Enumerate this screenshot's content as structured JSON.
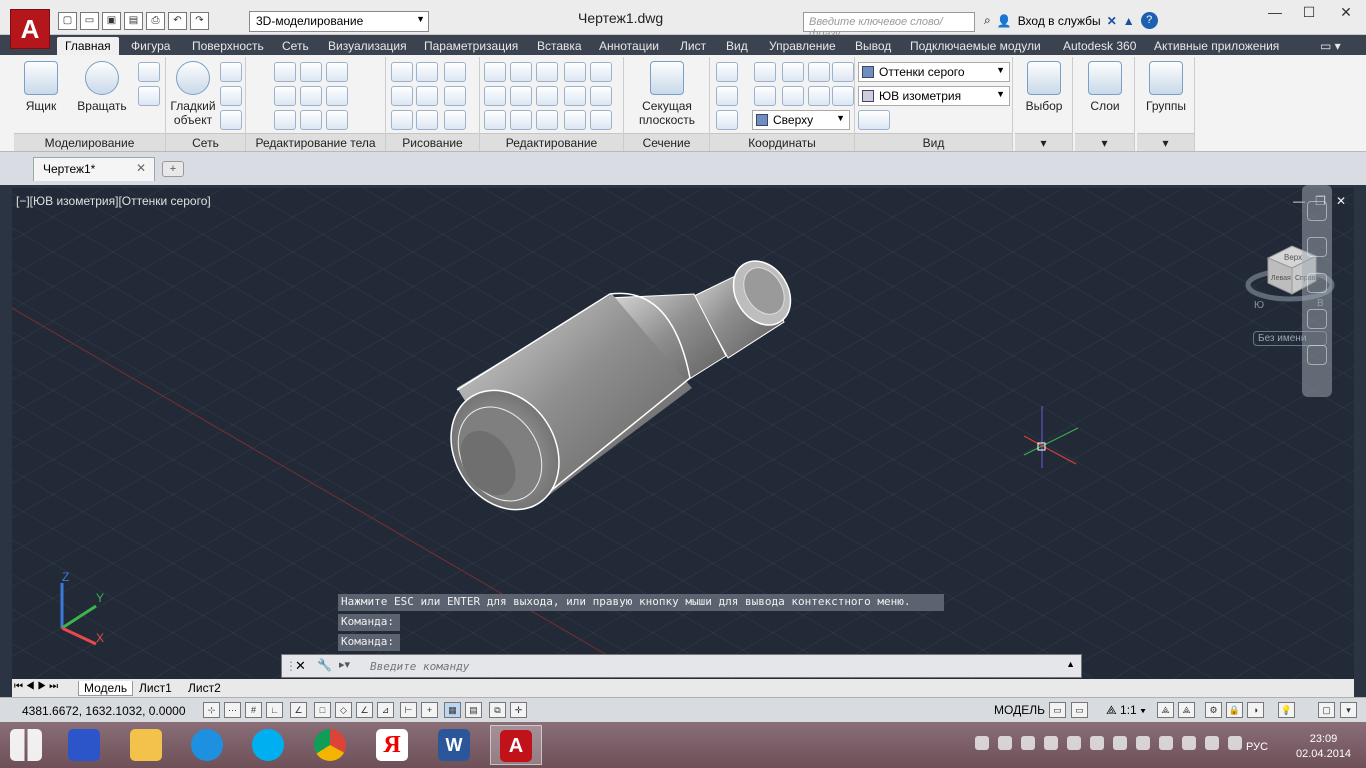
{
  "app": {
    "logo_letter": "A",
    "workspace": "3D-моделирование",
    "doc_title": "Чертеж1.dwg",
    "search_placeholder": "Введите ключевое слово/фразу",
    "signin_label": "Вход в службы"
  },
  "ribbon_tabs": [
    "Главная",
    "Фигура",
    "Поверхность",
    "Сеть",
    "Визуализация",
    "Параметризация",
    "Вставка",
    "Аннотации",
    "Лист",
    "Вид",
    "Управление",
    "Вывод",
    "Подключаемые модули",
    "Autodesk 360",
    "Активные приложения"
  ],
  "panels": {
    "modeling": {
      "label": "Моделирование",
      "box": "Ящик",
      "revolve": "Вращать"
    },
    "mesh": {
      "label": "Сеть",
      "smooth_l1": "Гладкий",
      "smooth_l2": "объект"
    },
    "solid_edit": {
      "label": "Редактирование тела"
    },
    "draw": {
      "label": "Рисование"
    },
    "modify": {
      "label": "Редактирование"
    },
    "section": {
      "label": "Сечение",
      "plane_l1": "Секущая",
      "plane_l2": "плоскость"
    },
    "coords": {
      "label": "Координаты",
      "ucs_view": "Сверху"
    },
    "view": {
      "label": "Вид",
      "visual_style": "Оттенки серого",
      "view_name": "ЮВ изометрия"
    },
    "selection": {
      "label": "Выбор"
    },
    "layers": {
      "label": "Слои"
    },
    "groups": {
      "label": "Группы"
    }
  },
  "file_tab": {
    "name": "Чертеж1*"
  },
  "viewport": {
    "label": "[−][ЮВ изометрия][Оттенки серого]",
    "viewcube_named": "Без имени",
    "viewcube_top": "Верх",
    "viewcube_left": "Левая",
    "viewcube_right": "Справа",
    "compass_s": "Ю",
    "compass_e": "В",
    "axis_z": "Z",
    "axis_y": "Y",
    "axis_x": "X"
  },
  "command": {
    "history": [
      "Нажмите ESC или ENTER для выхода, или правую кнопку мыши для вывода контекстного меню.",
      "Команда:",
      "Команда:"
    ],
    "input_placeholder": "Введите команду"
  },
  "layout_tabs": [
    "Модель",
    "Лист1",
    "Лист2"
  ],
  "status": {
    "coords": "4381.6672, 1632.1032, 0.0000",
    "space": "МОДЕЛЬ",
    "scale": "1:1"
  },
  "taskbar": {
    "apps": [
      "Windows",
      "Блокнот",
      "Проводник",
      "Internet Explorer",
      "Skype",
      "Chrome",
      "Яндекс",
      "Word",
      "AutoCAD"
    ],
    "lang": "РУС",
    "time": "23:09",
    "date": "02.04.2014"
  },
  "colors": {
    "accent_red": "#b5161b",
    "viewport_bg": "#222a37",
    "tab_bar": "#3c4350"
  }
}
